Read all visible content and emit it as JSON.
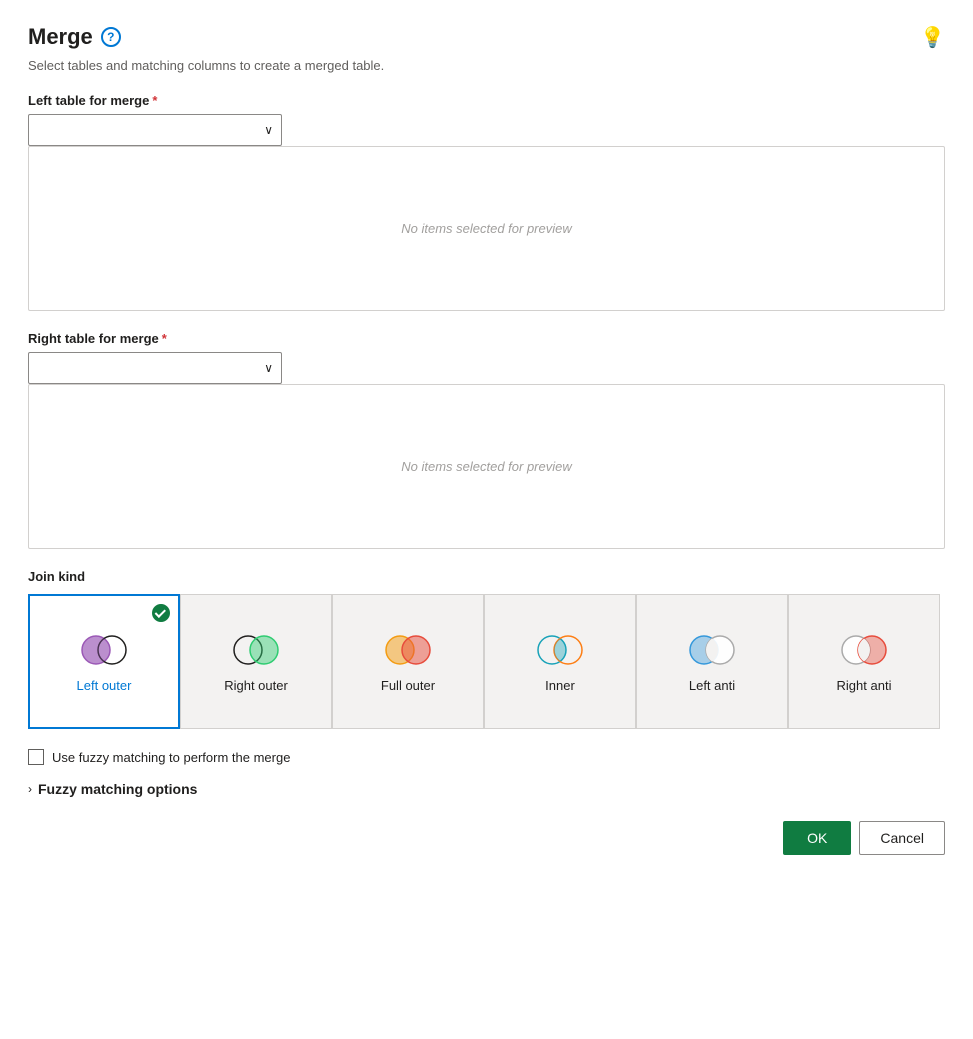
{
  "header": {
    "title": "Merge",
    "subtitle": "Select tables and matching columns to create a merged table."
  },
  "left_table": {
    "label": "Left table for merge",
    "required": true,
    "placeholder": "",
    "preview_text": "No items selected for preview"
  },
  "right_table": {
    "label": "Right table for merge",
    "required": true,
    "placeholder": "",
    "preview_text": "No items selected for preview"
  },
  "join_kind": {
    "label": "Join kind",
    "options": [
      {
        "id": "left-outer",
        "label": "Left outer",
        "selected": true
      },
      {
        "id": "right-outer",
        "label": "Right outer",
        "selected": false
      },
      {
        "id": "full-outer",
        "label": "Full outer",
        "selected": false
      },
      {
        "id": "inner",
        "label": "Inner",
        "selected": false
      },
      {
        "id": "left-anti",
        "label": "Left anti",
        "selected": false
      },
      {
        "id": "right-anti",
        "label": "Right anti",
        "selected": false
      }
    ]
  },
  "fuzzy": {
    "checkbox_label": "Use fuzzy matching to perform the merge",
    "options_label": "Fuzzy matching options",
    "checked": false
  },
  "buttons": {
    "ok": "OK",
    "cancel": "Cancel"
  }
}
